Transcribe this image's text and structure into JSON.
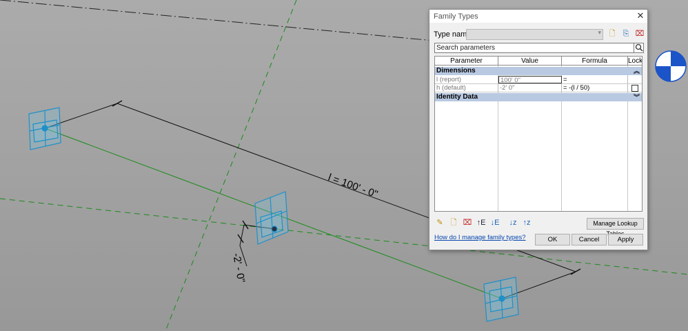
{
  "canvas": {
    "dimension_length": "l = 100' - 0\"",
    "dimension_height": "-2' - 0\""
  },
  "dialog": {
    "title": "Family Types",
    "type_name_label": "Type name:",
    "type_name_value": "",
    "toolbar_icons": [
      "new-type-icon",
      "rename-type-icon",
      "delete-type-icon"
    ],
    "search_placeholder": "Search parameters",
    "columns": [
      "Parameter",
      "Value",
      "Formula",
      "Lock"
    ],
    "groups": [
      {
        "name": "Dimensions",
        "expanded": true,
        "rows": [
          {
            "parameter": "l (report)",
            "value": "100'  0\"",
            "formula": "=",
            "lock": false
          },
          {
            "parameter": "h (default)",
            "value": "-2'  0\"",
            "formula": "= -(l / 50)",
            "lock": false
          }
        ]
      },
      {
        "name": "Identity Data",
        "expanded": false,
        "rows": []
      }
    ],
    "bottom_icons": [
      "edit-parameter-icon",
      "new-parameter-icon",
      "delete-parameter-icon",
      "move-up-icon",
      "move-down-icon",
      "sort-ascending-icon",
      "sort-descending-icon"
    ],
    "manage_lookup_label": "Manage Lookup Tables",
    "help_link": "How do I manage family types?",
    "ok_label": "OK",
    "cancel_label": "Cancel",
    "apply_label": "Apply"
  },
  "colors": {
    "accent": "#1e90c8",
    "group_header": "#b8c9e1",
    "link": "#0645ad",
    "reference_line_green": "#1a8a1a"
  }
}
